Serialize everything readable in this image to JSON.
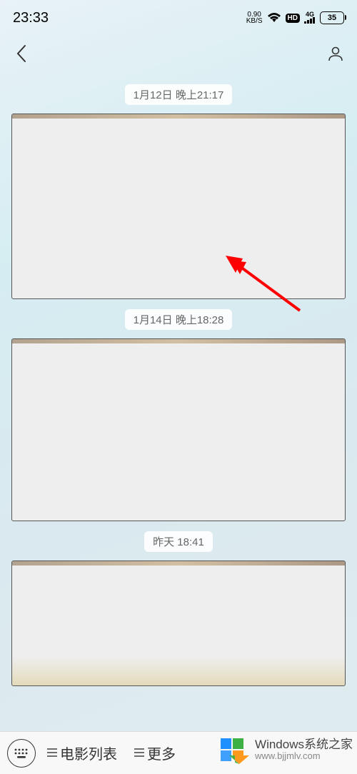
{
  "status": {
    "time": "23:33",
    "net_speed_value": "0.90",
    "net_speed_unit": "KB/S",
    "hd_label": "HD",
    "sig_label_top": "4G",
    "battery_level": "35"
  },
  "timestamps": [
    "1月12日 晚上21:17",
    "1月14日 晚上18:28",
    "昨天 18:41"
  ],
  "bottom_menu": {
    "item1": "电影列表",
    "item2_partial": "更多"
  },
  "watermark": {
    "title": "Windows系统之家",
    "url": "www.bjjmlv.com"
  },
  "colors": {
    "arrow": "#ff0000",
    "logo_blue": "#1e90ff",
    "logo_green": "#3cb043",
    "logo_orange": "#ff9a1f"
  }
}
